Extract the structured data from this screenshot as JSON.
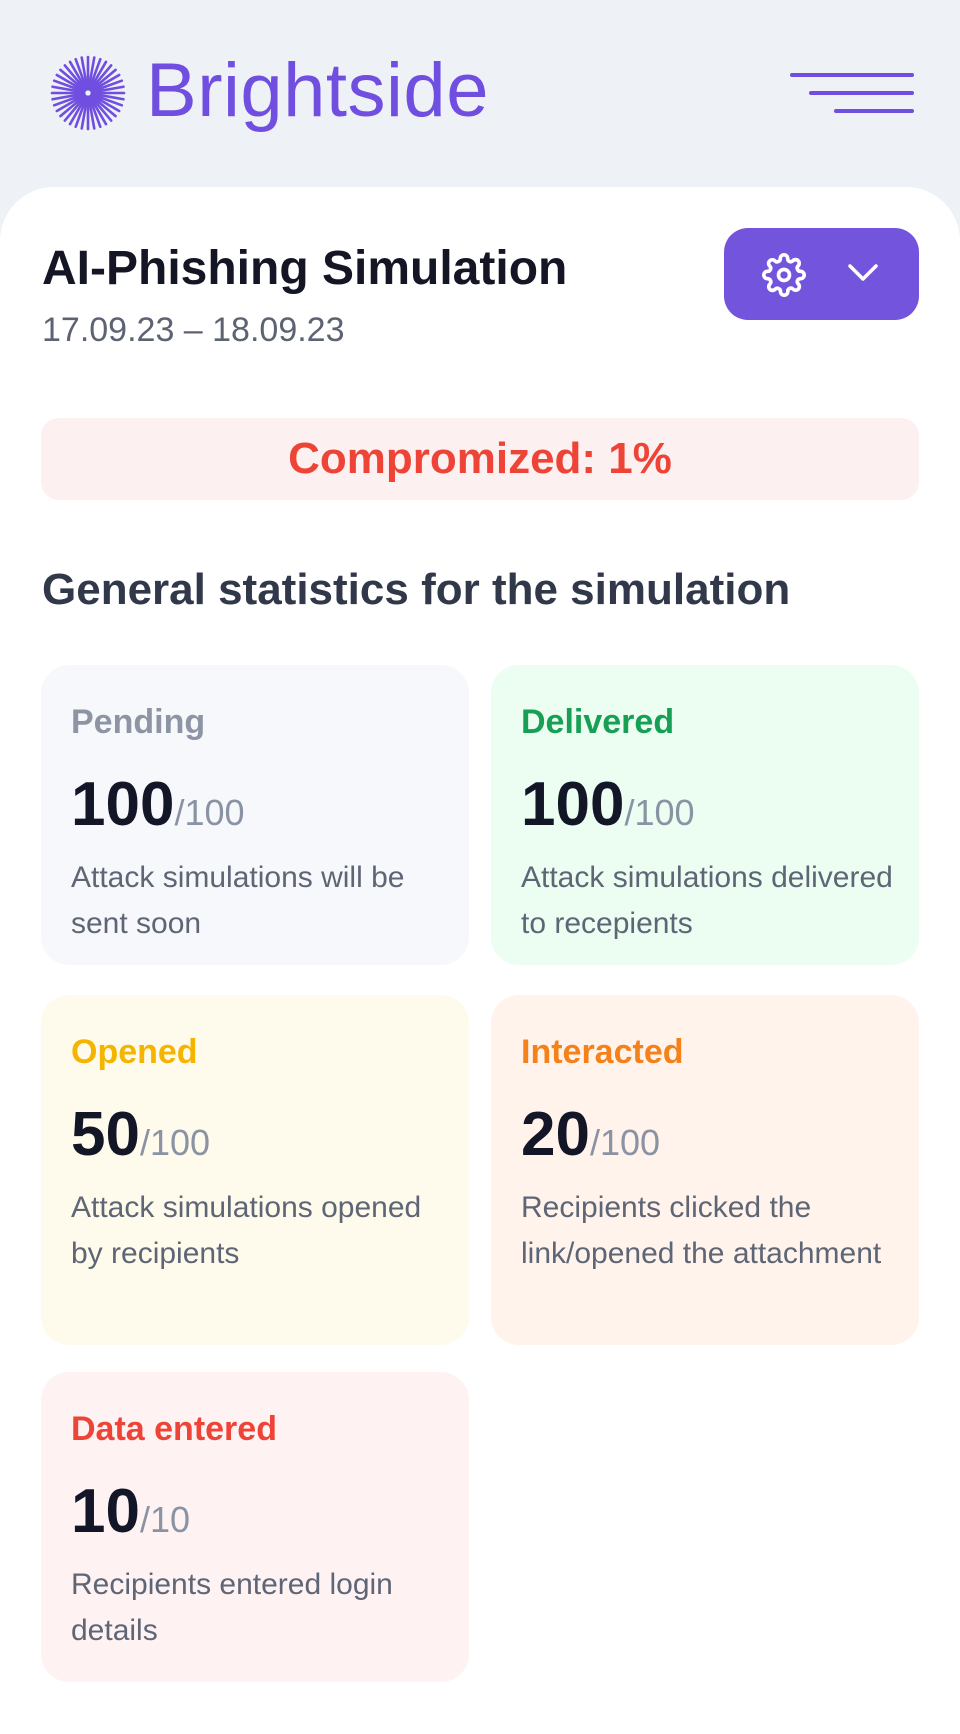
{
  "brand": {
    "name": "Brightside",
    "color": "#6f4ee0",
    "logo_icon": "starburst-icon",
    "menu_icon": "hamburger-menu-icon"
  },
  "simulation": {
    "title": "AI-Phishing Simulation",
    "dates": "17.09.23 – 18.09.23",
    "settings_icon": "gear-icon",
    "dropdown_icon": "chevron-down-icon"
  },
  "compromised": {
    "text": "Compromized: 1%",
    "percent": 1,
    "color": "#ee4437"
  },
  "stats": {
    "title": "General statistics for the simulation",
    "items": [
      {
        "label": "Pending",
        "value": "100",
        "total": "/100",
        "description": "Attack simulations will be sent soon",
        "color": "#8d95a4"
      },
      {
        "label": "Delivered",
        "value": "100",
        "total": "/100",
        "description": "Attack simulations delivered to recepients",
        "color": "#17a055"
      },
      {
        "label": "Opened",
        "value": "50",
        "total": "/100",
        "description": "Attack simulations opened by recipients",
        "color": "#f4b400"
      },
      {
        "label": "Interacted",
        "value": "20",
        "total": "/100",
        "description": "Recipients clicked the link/opened the attachment",
        "color": "#f48119"
      },
      {
        "label": "Data entered",
        "value": "10",
        "total": "/10",
        "description": "Recipients entered login details",
        "color": "#ee4437"
      }
    ]
  }
}
